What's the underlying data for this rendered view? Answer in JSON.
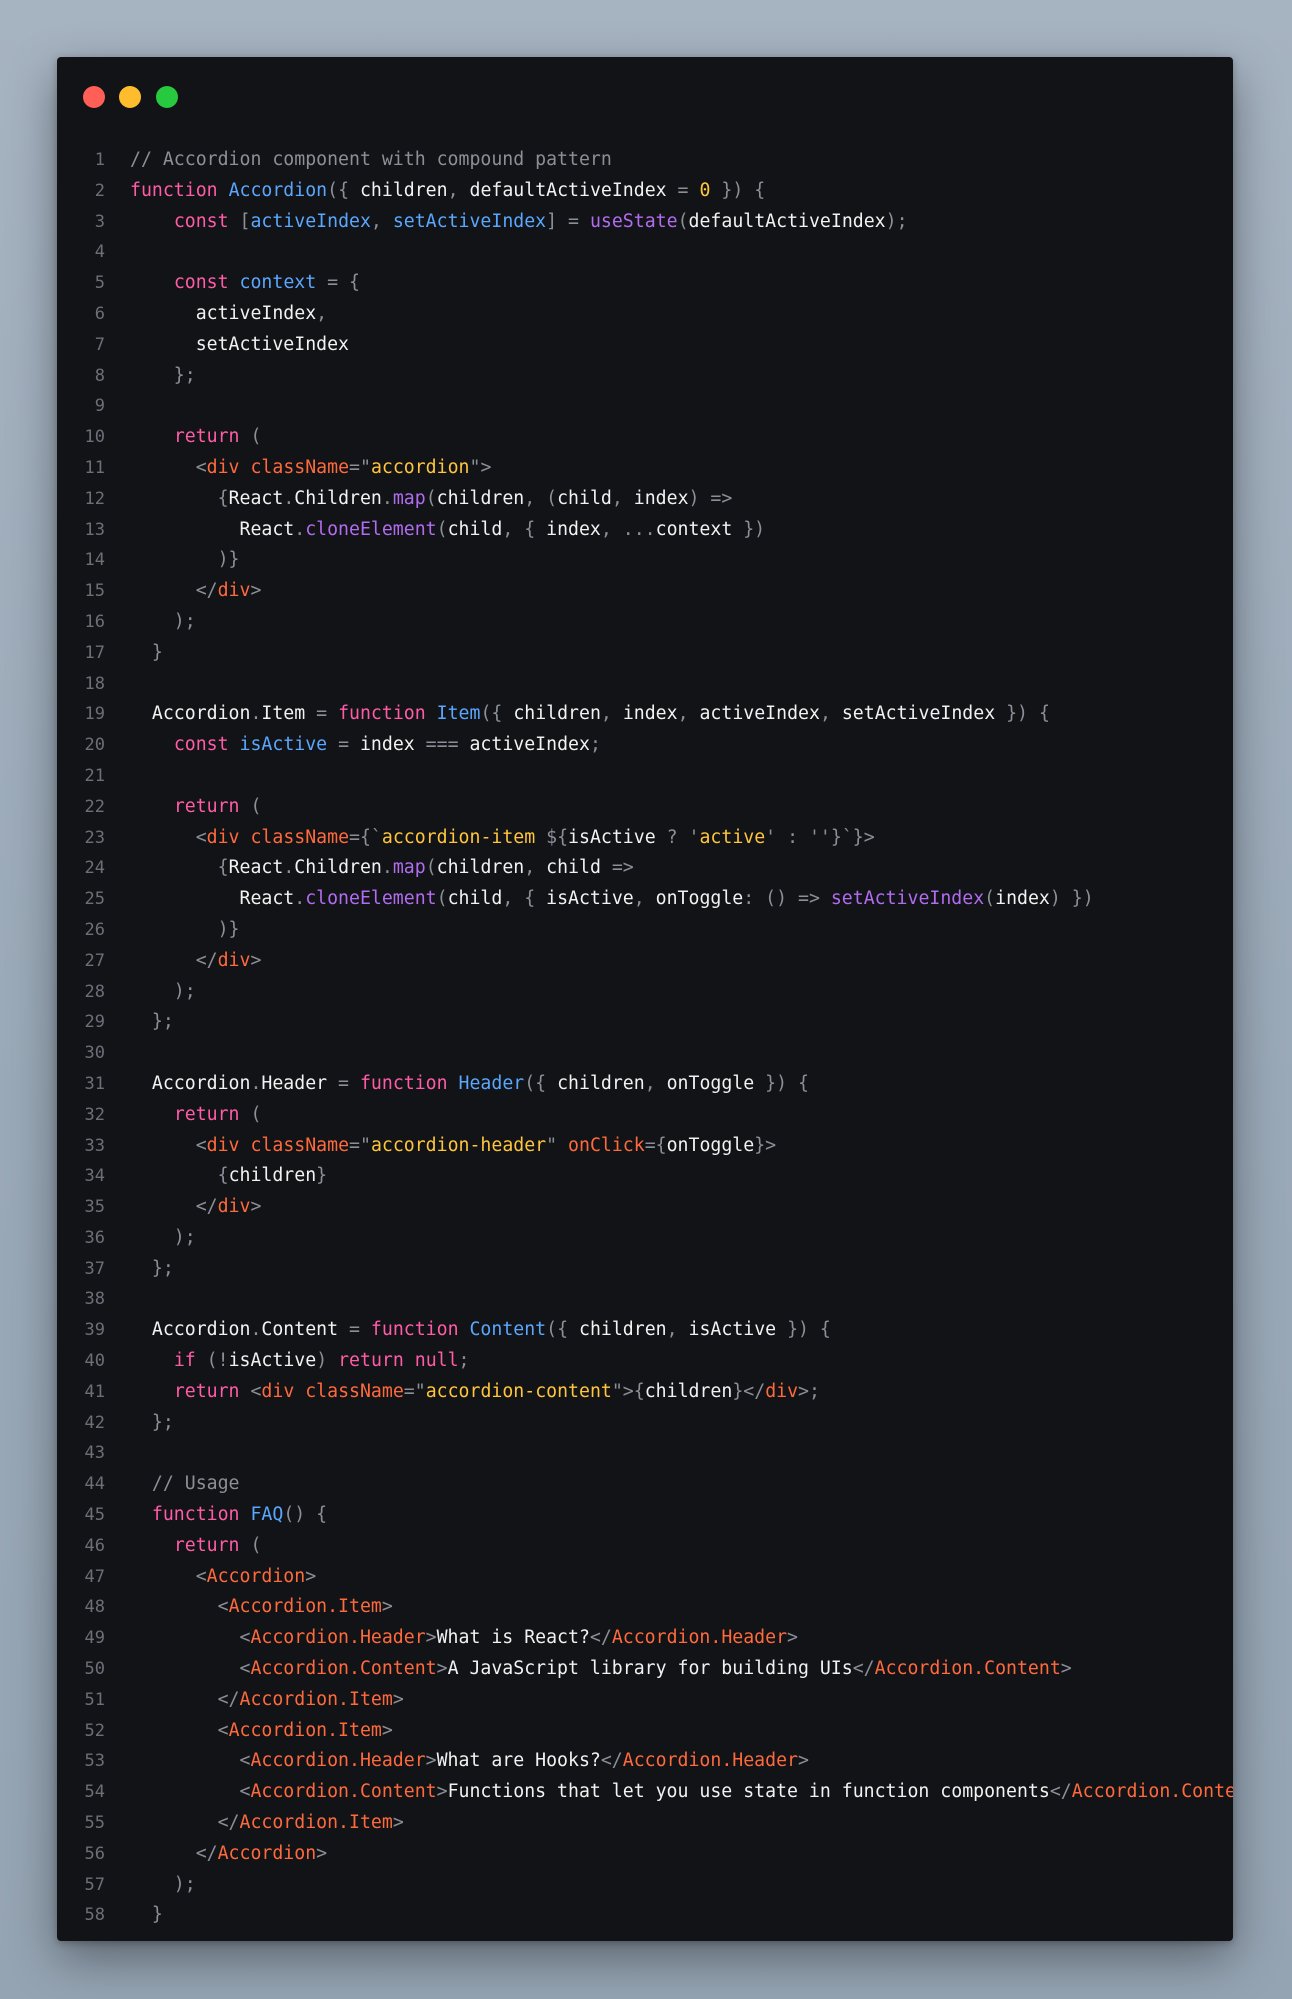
{
  "window": {
    "controls": [
      "close",
      "minimize",
      "maximize"
    ],
    "colors": {
      "close": "#ff5f56",
      "minimize": "#ffbd2e",
      "maximize": "#27c93f"
    }
  },
  "code": {
    "language": "jsx",
    "lines": [
      [
        [
          "c",
          "// Accordion component with compound pattern"
        ]
      ],
      [
        [
          "k",
          "function "
        ],
        [
          "f",
          "Accordion"
        ],
        [
          "p",
          "({ "
        ],
        [
          "i",
          "children"
        ],
        [
          "p",
          ", "
        ],
        [
          "i",
          "defaultActiveIndex"
        ],
        [
          "p",
          " = "
        ],
        [
          "n",
          "0"
        ],
        [
          "p",
          " }) {"
        ]
      ],
      [
        [
          "i",
          "    "
        ],
        [
          "k",
          "const "
        ],
        [
          "p",
          "["
        ],
        [
          "f",
          "activeIndex"
        ],
        [
          "p",
          ", "
        ],
        [
          "f",
          "setActiveIndex"
        ],
        [
          "p",
          "] = "
        ],
        [
          "m",
          "useState"
        ],
        [
          "p",
          "("
        ],
        [
          "i",
          "defaultActiveIndex"
        ],
        [
          "p",
          ");"
        ]
      ],
      [],
      [
        [
          "i",
          "    "
        ],
        [
          "k",
          "const "
        ],
        [
          "f",
          "context"
        ],
        [
          "p",
          " = {"
        ]
      ],
      [
        [
          "i",
          "      activeIndex"
        ],
        [
          "p",
          ","
        ]
      ],
      [
        [
          "i",
          "      setActiveIndex"
        ]
      ],
      [
        [
          "p",
          "    };"
        ]
      ],
      [],
      [
        [
          "i",
          "    "
        ],
        [
          "k",
          "return "
        ],
        [
          "p",
          "("
        ]
      ],
      [
        [
          "p",
          "      <"
        ],
        [
          "t",
          "div "
        ],
        [
          "a",
          "className"
        ],
        [
          "p",
          "=\""
        ],
        [
          "s",
          "accordion"
        ],
        [
          "p",
          "\">"
        ]
      ],
      [
        [
          "p",
          "        {"
        ],
        [
          "i",
          "React"
        ],
        [
          "p",
          "."
        ],
        [
          "i",
          "Children"
        ],
        [
          "p",
          "."
        ],
        [
          "m",
          "map"
        ],
        [
          "p",
          "("
        ],
        [
          "i",
          "children"
        ],
        [
          "p",
          ", ("
        ],
        [
          "i",
          "child"
        ],
        [
          "p",
          ", "
        ],
        [
          "i",
          "index"
        ],
        [
          "p",
          ") =>"
        ]
      ],
      [
        [
          "i",
          "          React"
        ],
        [
          "p",
          "."
        ],
        [
          "m",
          "cloneElement"
        ],
        [
          "p",
          "("
        ],
        [
          "i",
          "child"
        ],
        [
          "p",
          ", { "
        ],
        [
          "i",
          "index"
        ],
        [
          "p",
          ", ..."
        ],
        [
          "i",
          "context"
        ],
        [
          "p",
          " })"
        ]
      ],
      [
        [
          "p",
          "        )}"
        ]
      ],
      [
        [
          "p",
          "      </"
        ],
        [
          "t",
          "div"
        ],
        [
          "p",
          ">"
        ]
      ],
      [
        [
          "p",
          "    );"
        ]
      ],
      [
        [
          "p",
          "  }"
        ]
      ],
      [],
      [
        [
          "i",
          "  Accordion"
        ],
        [
          "p",
          "."
        ],
        [
          "i",
          "Item"
        ],
        [
          "p",
          " = "
        ],
        [
          "k",
          "function "
        ],
        [
          "f",
          "Item"
        ],
        [
          "p",
          "({ "
        ],
        [
          "i",
          "children"
        ],
        [
          "p",
          ", "
        ],
        [
          "i",
          "index"
        ],
        [
          "p",
          ", "
        ],
        [
          "i",
          "activeIndex"
        ],
        [
          "p",
          ", "
        ],
        [
          "i",
          "setActiveIndex"
        ],
        [
          "p",
          " }) {"
        ]
      ],
      [
        [
          "i",
          "    "
        ],
        [
          "k",
          "const "
        ],
        [
          "f",
          "isActive"
        ],
        [
          "p",
          " = "
        ],
        [
          "i",
          "index"
        ],
        [
          "p",
          " === "
        ],
        [
          "i",
          "activeIndex"
        ],
        [
          "p",
          ";"
        ]
      ],
      [],
      [
        [
          "i",
          "    "
        ],
        [
          "k",
          "return "
        ],
        [
          "p",
          "("
        ]
      ],
      [
        [
          "p",
          "      <"
        ],
        [
          "t",
          "div "
        ],
        [
          "a",
          "className"
        ],
        [
          "p",
          "={`"
        ],
        [
          "s",
          "accordion-item "
        ],
        [
          "p",
          "${"
        ],
        [
          "i",
          "isActive"
        ],
        [
          "p",
          " ? '"
        ],
        [
          "s",
          "active"
        ],
        [
          "p",
          "' : ''}`}>"
        ]
      ],
      [
        [
          "p",
          "        {"
        ],
        [
          "i",
          "React"
        ],
        [
          "p",
          "."
        ],
        [
          "i",
          "Children"
        ],
        [
          "p",
          "."
        ],
        [
          "m",
          "map"
        ],
        [
          "p",
          "("
        ],
        [
          "i",
          "children"
        ],
        [
          "p",
          ", "
        ],
        [
          "i",
          "child"
        ],
        [
          "p",
          " =>"
        ]
      ],
      [
        [
          "i",
          "          React"
        ],
        [
          "p",
          "."
        ],
        [
          "m",
          "cloneElement"
        ],
        [
          "p",
          "("
        ],
        [
          "i",
          "child"
        ],
        [
          "p",
          ", { "
        ],
        [
          "i",
          "isActive"
        ],
        [
          "p",
          ", "
        ],
        [
          "i",
          "onToggle"
        ],
        [
          "p",
          ": () => "
        ],
        [
          "m",
          "setActiveIndex"
        ],
        [
          "p",
          "("
        ],
        [
          "i",
          "index"
        ],
        [
          "p",
          ") })"
        ]
      ],
      [
        [
          "p",
          "        )}"
        ]
      ],
      [
        [
          "p",
          "      </"
        ],
        [
          "t",
          "div"
        ],
        [
          "p",
          ">"
        ]
      ],
      [
        [
          "p",
          "    );"
        ]
      ],
      [
        [
          "p",
          "  };"
        ]
      ],
      [],
      [
        [
          "i",
          "  Accordion"
        ],
        [
          "p",
          "."
        ],
        [
          "i",
          "Header"
        ],
        [
          "p",
          " = "
        ],
        [
          "k",
          "function "
        ],
        [
          "f",
          "Header"
        ],
        [
          "p",
          "({ "
        ],
        [
          "i",
          "children"
        ],
        [
          "p",
          ", "
        ],
        [
          "i",
          "onToggle"
        ],
        [
          "p",
          " }) {"
        ]
      ],
      [
        [
          "i",
          "    "
        ],
        [
          "k",
          "return "
        ],
        [
          "p",
          "("
        ]
      ],
      [
        [
          "p",
          "      <"
        ],
        [
          "t",
          "div "
        ],
        [
          "a",
          "className"
        ],
        [
          "p",
          "=\""
        ],
        [
          "s",
          "accordion-header"
        ],
        [
          "p",
          "\" "
        ],
        [
          "a",
          "onClick"
        ],
        [
          "p",
          "={"
        ],
        [
          "i",
          "onToggle"
        ],
        [
          "p",
          "}>"
        ]
      ],
      [
        [
          "p",
          "        {"
        ],
        [
          "i",
          "children"
        ],
        [
          "p",
          "}"
        ]
      ],
      [
        [
          "p",
          "      </"
        ],
        [
          "t",
          "div"
        ],
        [
          "p",
          ">"
        ]
      ],
      [
        [
          "p",
          "    );"
        ]
      ],
      [
        [
          "p",
          "  };"
        ]
      ],
      [],
      [
        [
          "i",
          "  Accordion"
        ],
        [
          "p",
          "."
        ],
        [
          "i",
          "Content"
        ],
        [
          "p",
          " = "
        ],
        [
          "k",
          "function "
        ],
        [
          "f",
          "Content"
        ],
        [
          "p",
          "({ "
        ],
        [
          "i",
          "children"
        ],
        [
          "p",
          ", "
        ],
        [
          "i",
          "isActive"
        ],
        [
          "p",
          " }) {"
        ]
      ],
      [
        [
          "i",
          "    "
        ],
        [
          "k",
          "if "
        ],
        [
          "p",
          "(!"
        ],
        [
          "i",
          "isActive"
        ],
        [
          "p",
          ") "
        ],
        [
          "k",
          "return null"
        ],
        [
          "p",
          ";"
        ]
      ],
      [
        [
          "i",
          "    "
        ],
        [
          "k",
          "return "
        ],
        [
          "p",
          "<"
        ],
        [
          "t",
          "div "
        ],
        [
          "a",
          "className"
        ],
        [
          "p",
          "=\""
        ],
        [
          "s",
          "accordion-content"
        ],
        [
          "p",
          "\">{"
        ],
        [
          "i",
          "children"
        ],
        [
          "p",
          "}</"
        ],
        [
          "t",
          "div"
        ],
        [
          "p",
          ">;"
        ]
      ],
      [
        [
          "p",
          "  };"
        ]
      ],
      [],
      [
        [
          "c",
          "  // Usage"
        ]
      ],
      [
        [
          "i",
          "  "
        ],
        [
          "k",
          "function "
        ],
        [
          "f",
          "FAQ"
        ],
        [
          "p",
          "() {"
        ]
      ],
      [
        [
          "i",
          "    "
        ],
        [
          "k",
          "return "
        ],
        [
          "p",
          "("
        ]
      ],
      [
        [
          "p",
          "      <"
        ],
        [
          "t",
          "Accordion"
        ],
        [
          "p",
          ">"
        ]
      ],
      [
        [
          "p",
          "        <"
        ],
        [
          "t",
          "Accordion.Item"
        ],
        [
          "p",
          ">"
        ]
      ],
      [
        [
          "p",
          "          <"
        ],
        [
          "t",
          "Accordion.Header"
        ],
        [
          "p",
          ">"
        ],
        [
          "i",
          "What is React?"
        ],
        [
          "p",
          "</"
        ],
        [
          "t",
          "Accordion.Header"
        ],
        [
          "p",
          ">"
        ]
      ],
      [
        [
          "p",
          "          <"
        ],
        [
          "t",
          "Accordion.Content"
        ],
        [
          "p",
          ">"
        ],
        [
          "i",
          "A JavaScript library for building UIs"
        ],
        [
          "p",
          "</"
        ],
        [
          "t",
          "Accordion.Content"
        ],
        [
          "p",
          ">"
        ]
      ],
      [
        [
          "p",
          "        </"
        ],
        [
          "t",
          "Accordion.Item"
        ],
        [
          "p",
          ">"
        ]
      ],
      [
        [
          "p",
          "        <"
        ],
        [
          "t",
          "Accordion.Item"
        ],
        [
          "p",
          ">"
        ]
      ],
      [
        [
          "p",
          "          <"
        ],
        [
          "t",
          "Accordion.Header"
        ],
        [
          "p",
          ">"
        ],
        [
          "i",
          "What are Hooks?"
        ],
        [
          "p",
          "</"
        ],
        [
          "t",
          "Accordion.Header"
        ],
        [
          "p",
          ">"
        ]
      ],
      [
        [
          "p",
          "          <"
        ],
        [
          "t",
          "Accordion.Content"
        ],
        [
          "p",
          ">"
        ],
        [
          "i",
          "Functions that let you use state in function components"
        ],
        [
          "p",
          "</"
        ],
        [
          "t",
          "Accordion.Content"
        ],
        [
          "p",
          ">"
        ]
      ],
      [
        [
          "p",
          "        </"
        ],
        [
          "t",
          "Accordion.Item"
        ],
        [
          "p",
          ">"
        ]
      ],
      [
        [
          "p",
          "      </"
        ],
        [
          "t",
          "Accordion"
        ],
        [
          "p",
          ">"
        ]
      ],
      [
        [
          "p",
          "    );"
        ]
      ],
      [
        [
          "p",
          "  }"
        ]
      ]
    ]
  }
}
